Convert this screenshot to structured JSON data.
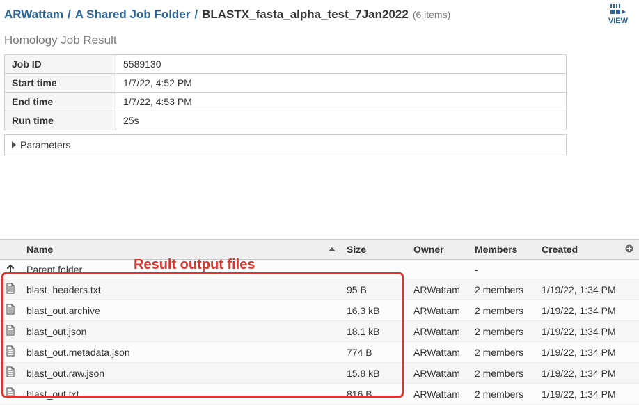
{
  "breadcrumb": {
    "links": [
      "ARWattam",
      "A Shared Job Folder"
    ],
    "current": "BLASTX_fasta_alpha_test_7Jan2022",
    "count": "(6 items)"
  },
  "view_label": "VIEW",
  "section_title": "Homology Job Result",
  "meta": {
    "job_id": {
      "k": "Job ID",
      "v": "5589130"
    },
    "start_time": {
      "k": "Start time",
      "v": "1/7/22, 4:52 PM"
    },
    "end_time": {
      "k": "End time",
      "v": "1/7/22, 4:53 PM"
    },
    "run_time": {
      "k": "Run time",
      "v": "25s"
    }
  },
  "parameters_label": "Parameters",
  "columns": {
    "name": "Name",
    "size": "Size",
    "owner": "Owner",
    "members": "Members",
    "created": "Created"
  },
  "parent_folder_label": "Parent folder",
  "parent_folder_members": "-",
  "files": [
    {
      "name": "blast_headers.txt",
      "size": "95 B",
      "owner": "ARWattam",
      "members": "2 members",
      "created": "1/19/22, 1:34 PM"
    },
    {
      "name": "blast_out.archive",
      "size": "16.3 kB",
      "owner": "ARWattam",
      "members": "2 members",
      "created": "1/19/22, 1:34 PM"
    },
    {
      "name": "blast_out.json",
      "size": "18.1 kB",
      "owner": "ARWattam",
      "members": "2 members",
      "created": "1/19/22, 1:34 PM"
    },
    {
      "name": "blast_out.metadata.json",
      "size": "774 B",
      "owner": "ARWattam",
      "members": "2 members",
      "created": "1/19/22, 1:34 PM"
    },
    {
      "name": "blast_out.raw.json",
      "size": "15.8 kB",
      "owner": "ARWattam",
      "members": "2 members",
      "created": "1/19/22, 1:34 PM"
    },
    {
      "name": "blast_out.txt",
      "size": "816 B",
      "owner": "ARWattam",
      "members": "2 members",
      "created": "1/19/22, 1:34 PM"
    }
  ],
  "annotation_text": "Result output files"
}
